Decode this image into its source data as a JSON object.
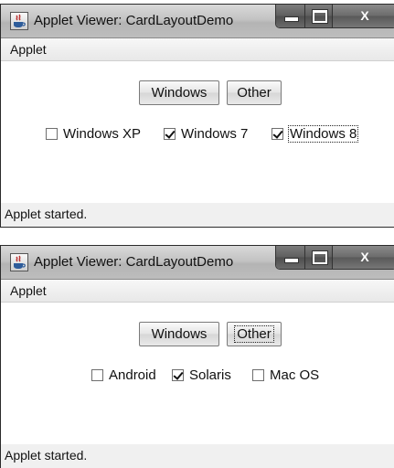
{
  "windows": [
    {
      "title": "Applet Viewer: CardLayoutDemo",
      "menu": [
        "Applet"
      ],
      "buttons": {
        "windows": "Windows",
        "other": "Other"
      },
      "checkboxes": [
        {
          "label": "Windows XP",
          "checked": false
        },
        {
          "label": "Windows 7",
          "checked": true
        },
        {
          "label": "Windows 8",
          "checked": true
        }
      ],
      "status": "Applet started.",
      "focused_control": "Windows 8"
    },
    {
      "title": "Applet Viewer: CardLayoutDemo",
      "menu": [
        "Applet"
      ],
      "buttons": {
        "windows": "Windows",
        "other": "Other"
      },
      "checkboxes": [
        {
          "label": "Android",
          "checked": false
        },
        {
          "label": "Solaris",
          "checked": true
        },
        {
          "label": "Mac OS",
          "checked": false
        }
      ],
      "status": "Applet started.",
      "focused_control": "Other"
    }
  ],
  "controls": {
    "close_glyph": "X"
  }
}
